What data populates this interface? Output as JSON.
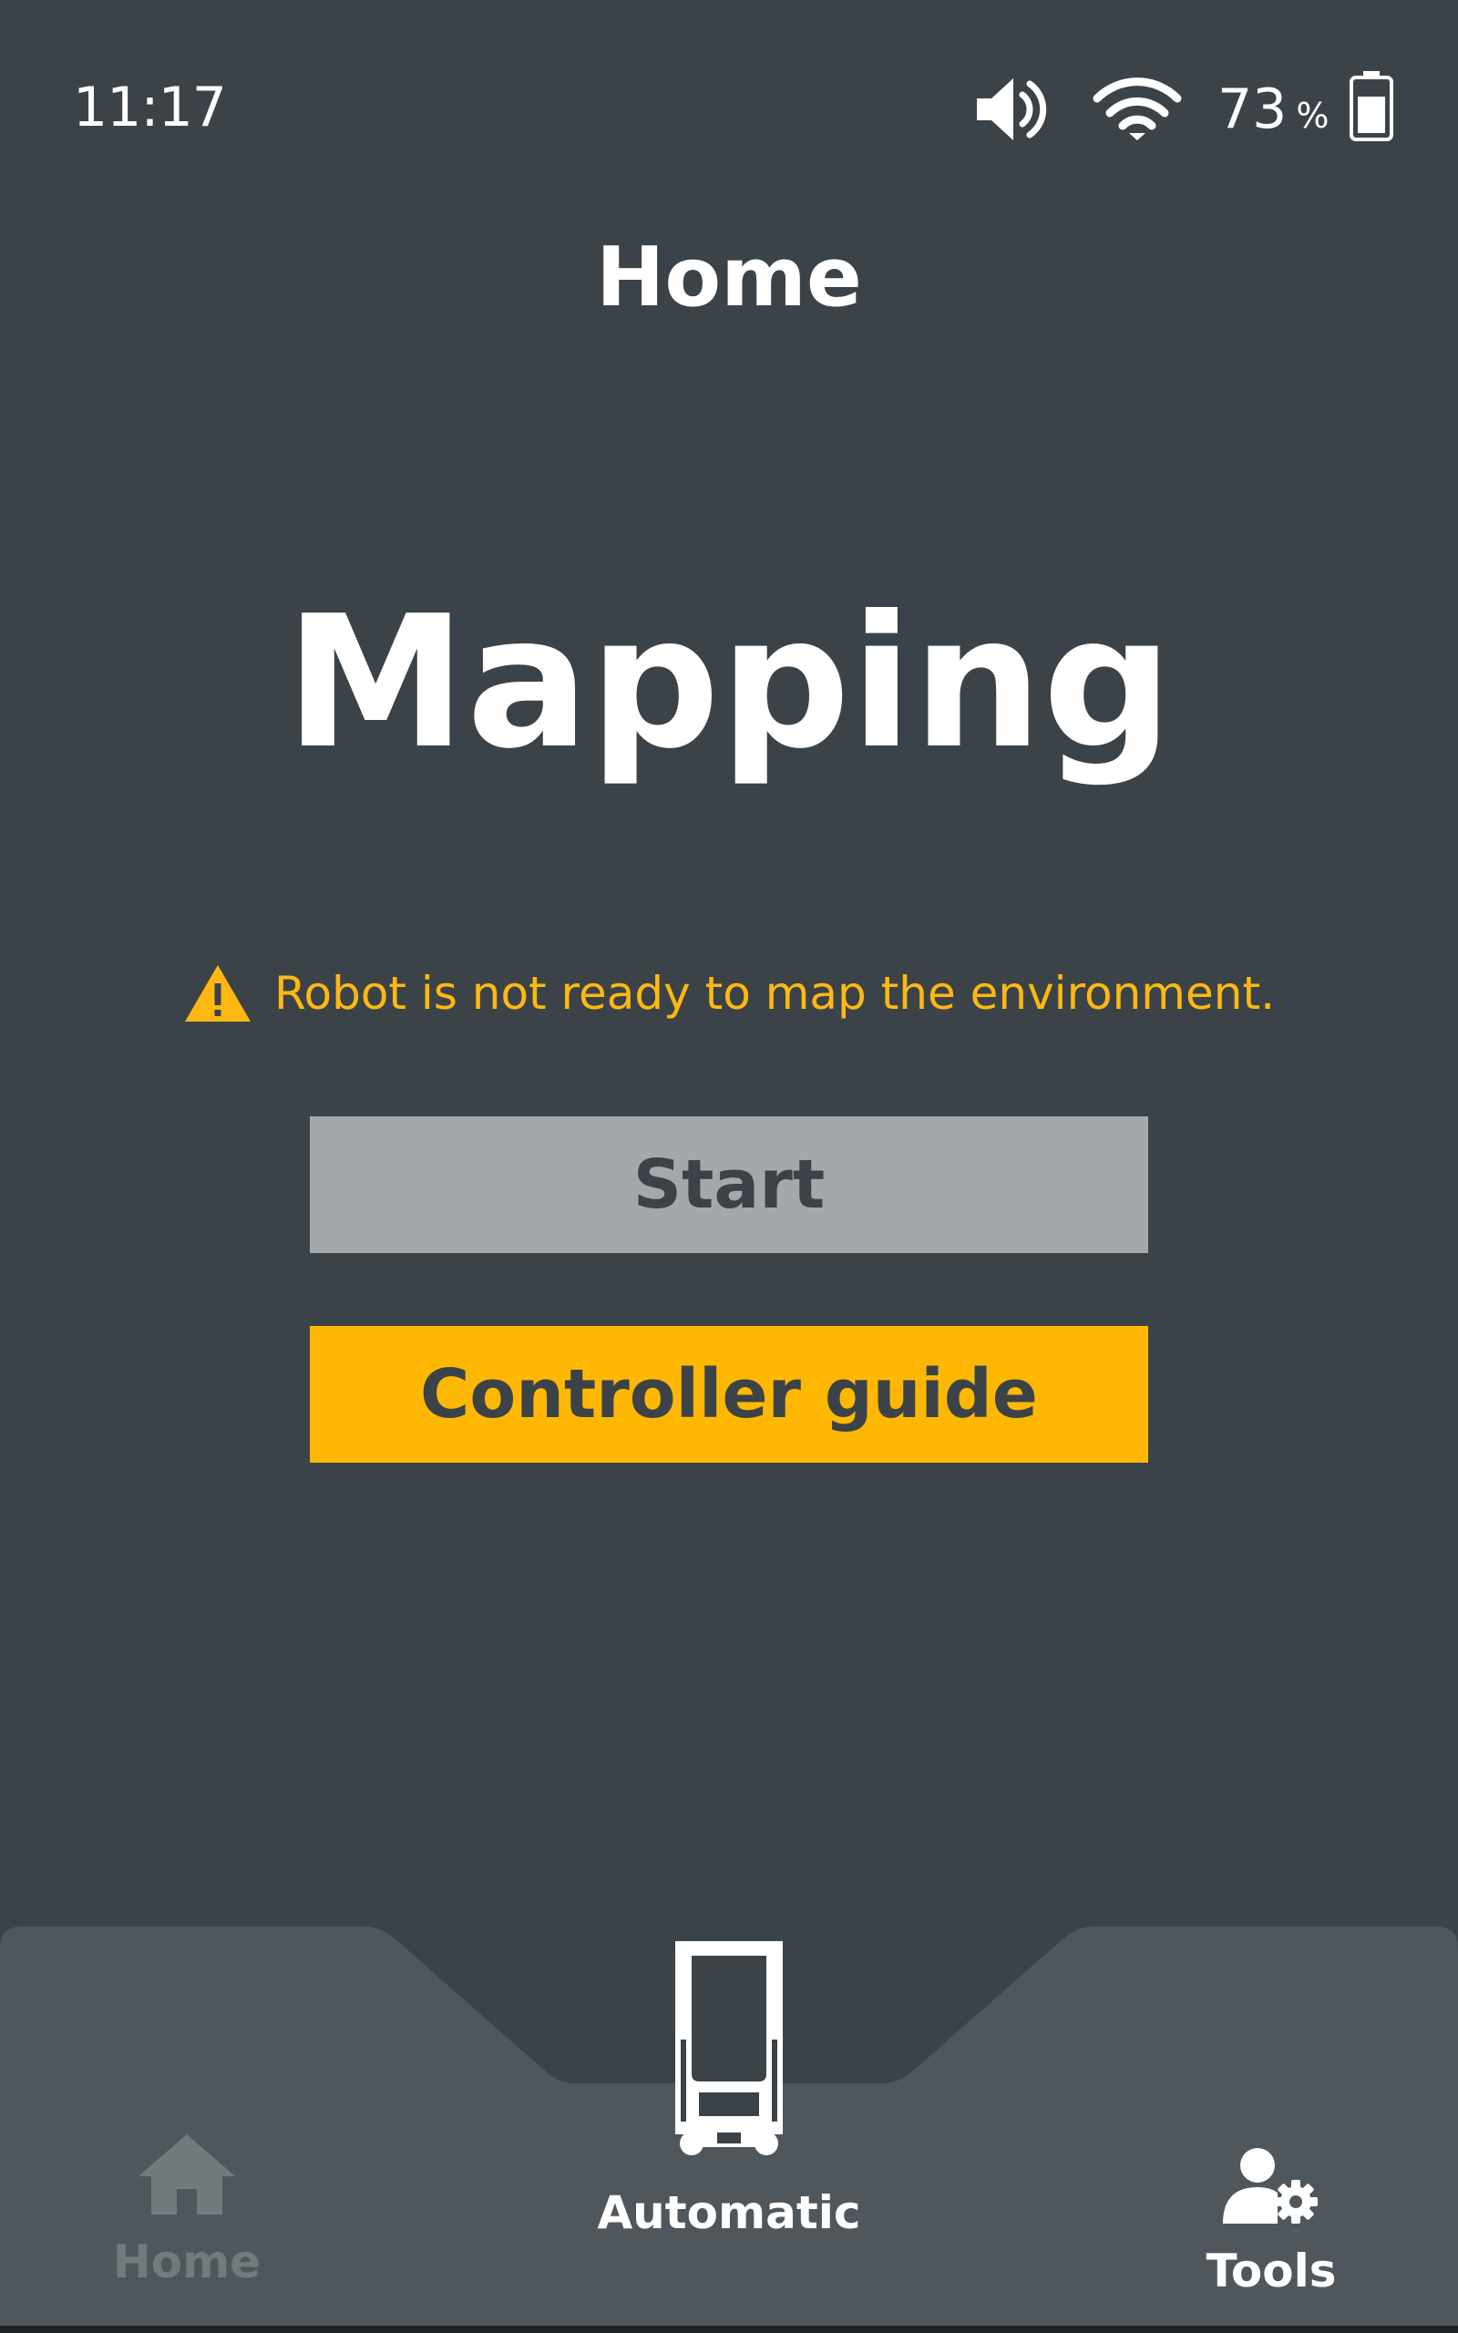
{
  "status_bar": {
    "time": "11:17",
    "battery_level": "73",
    "battery_unit": "%",
    "icons": [
      "volume-icon",
      "wifi-icon",
      "battery-icon"
    ]
  },
  "header": {
    "title": "Home"
  },
  "main": {
    "mode_title": "Mapping",
    "warning_text": "Robot is not ready to map the environment.",
    "start_label": "Start",
    "guide_label": "Controller guide"
  },
  "bottom_nav": {
    "items": [
      {
        "label": "Home",
        "icon": "home-icon",
        "state": "disabled"
      },
      {
        "label": "Automatic",
        "icon": "robot-icon",
        "state": "active"
      },
      {
        "label": "Tools",
        "icon": "user-settings-icon",
        "state": "enabled"
      }
    ]
  },
  "colors": {
    "background": "#3c4348",
    "nav_background": "#50575c",
    "warning": "#fdb813",
    "primary_button": "#feb804",
    "disabled_button": "#a4a8ab",
    "inactive_nav": "#737a7e"
  }
}
